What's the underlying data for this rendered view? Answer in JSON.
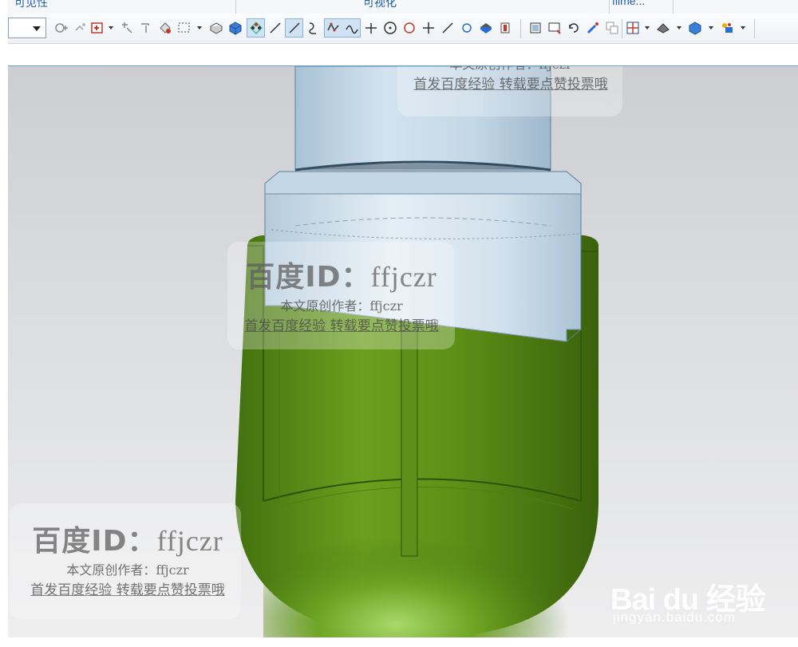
{
  "header": {
    "tab_left": "可见性",
    "tab_center": "可视化",
    "tab_right": "filme..."
  },
  "toolbar": {
    "combo_value": "",
    "icons": [
      "select-filter-icon",
      "snap-icon",
      "add-point-icon",
      "edit-icon",
      "move-icon",
      "rectangle-select-icon",
      "box-icon",
      "cube-icon",
      "pattern-icon",
      "line-icon",
      "line-icon",
      "spline-icon",
      "polyline-icon",
      "curve-icon",
      "intersect-icon",
      "circle-icon",
      "polygon-icon",
      "plus-icon",
      "line-icon",
      "arc-icon",
      "render-icon",
      "shaded-icon",
      "view-icon",
      "window-icon",
      "rotate-icon",
      "paint-icon",
      "copy-icon",
      "grid-icon",
      "solid-icon",
      "cube-icon",
      "palette-icon"
    ]
  },
  "watermark": {
    "id_prefix": "百度ID：",
    "id_name": "ffjczr",
    "author_line": "本文原创作者：ffjczr",
    "cta_line": "首发百度经验 转载要点赞投票哦"
  },
  "brand": {
    "logo": "Bai du 经验",
    "url": "jingyan.baidu.com"
  },
  "colors": {
    "part_green": "#6a9c1e",
    "cap_blue": "#c8dbe8",
    "accent": "#1f5fa8"
  }
}
